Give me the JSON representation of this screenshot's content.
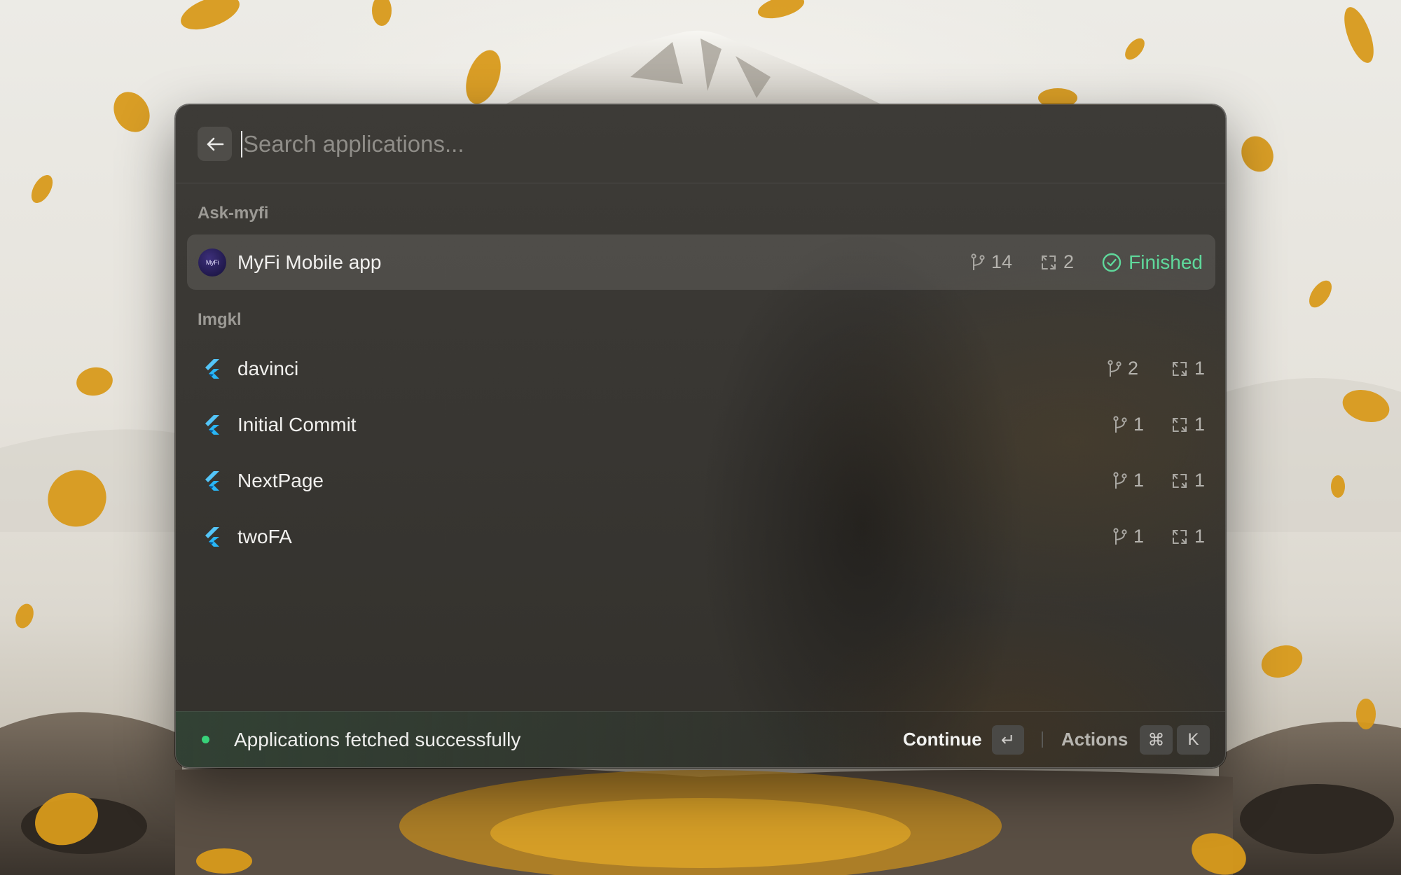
{
  "search": {
    "placeholder": "Search applications..."
  },
  "back_icon": "arrow-left-icon",
  "groups": [
    {
      "label": "Ask-myfi",
      "items": [
        {
          "name": "MyFi Mobile app",
          "icon": "myfi-avatar",
          "avatar_text": "MyFi",
          "branches": "14",
          "builds": "2",
          "status": "Finished",
          "selected": true
        }
      ]
    },
    {
      "label": "Imgkl",
      "items": [
        {
          "name": "davinci",
          "icon": "flutter-icon",
          "branches": "2",
          "builds": "1"
        },
        {
          "name": "Initial Commit",
          "icon": "flutter-icon",
          "branches": "1",
          "builds": "1"
        },
        {
          "name": "NextPage",
          "icon": "flutter-icon",
          "branches": "1",
          "builds": "1"
        },
        {
          "name": "twoFA",
          "icon": "flutter-icon",
          "branches": "1",
          "builds": "1"
        }
      ]
    }
  ],
  "footer": {
    "message": "Applications fetched successfully",
    "continue_label": "Continue",
    "continue_key": "↵",
    "actions_label": "Actions",
    "actions_keys": [
      "⌘",
      "K"
    ]
  },
  "colors": {
    "success": "#5fd89b",
    "status_dot": "#38d27a",
    "window_bg": "#383632",
    "flutter_light": "#54c5f8",
    "flutter_dark": "#01579b"
  }
}
